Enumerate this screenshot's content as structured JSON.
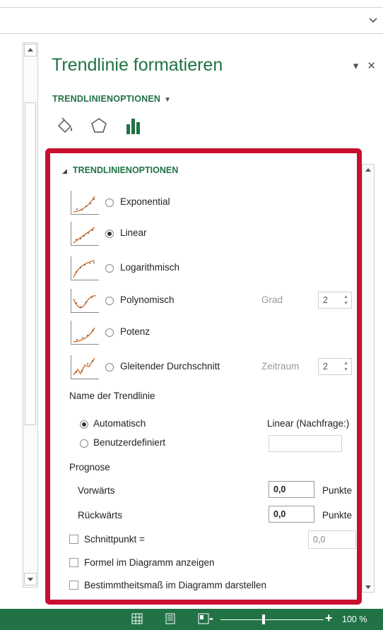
{
  "pane": {
    "title": "Trendlinie formatieren",
    "options_dropdown": "TRENDLINIENOPTIONEN",
    "section_header": "TRENDLINIENOPTIONEN",
    "icons": [
      "fill-line-icon",
      "effects-pentagon-icon",
      "trendline-options-bar-chart-icon"
    ]
  },
  "trend_types": {
    "exponential": "Exponential",
    "linear": "Linear",
    "logarithmic": "Logarithmisch",
    "polynomial": "Polynomisch",
    "power": "Potenz",
    "moving_average": "Gleitender Durchschnitt",
    "selected": "Linear"
  },
  "polynomial_order": {
    "label": "Grad",
    "value": "2"
  },
  "moving_average_period": {
    "label": "Zeitraum",
    "value": "2"
  },
  "trendline_name": {
    "heading": "Name der Trendlinie",
    "automatic_label": "Automatisch",
    "automatic_value": "Linear (Nachfrage:)",
    "custom_label": "Benutzerdefiniert",
    "custom_value": "",
    "selected": "Automatisch"
  },
  "forecast": {
    "heading": "Prognose",
    "forward_label": "Vorwärts",
    "forward_value": "0,0",
    "backward_label": "Rückwärts",
    "backward_value": "0,0",
    "unit": "Punkte"
  },
  "intercept": {
    "label": "Schnittpunkt =",
    "value": "0,0",
    "checked": false
  },
  "display_equation": {
    "label": "Formel im Diagramm anzeigen",
    "checked": false
  },
  "display_r_squared": {
    "label": "Bestimmtheitsmaß im Diagramm darstellen",
    "checked": false
  },
  "status_bar": {
    "zoom": "100 %",
    "accent": "#217346"
  },
  "colors": {
    "accent_green": "#207245",
    "highlight_red": "#c8102e"
  }
}
